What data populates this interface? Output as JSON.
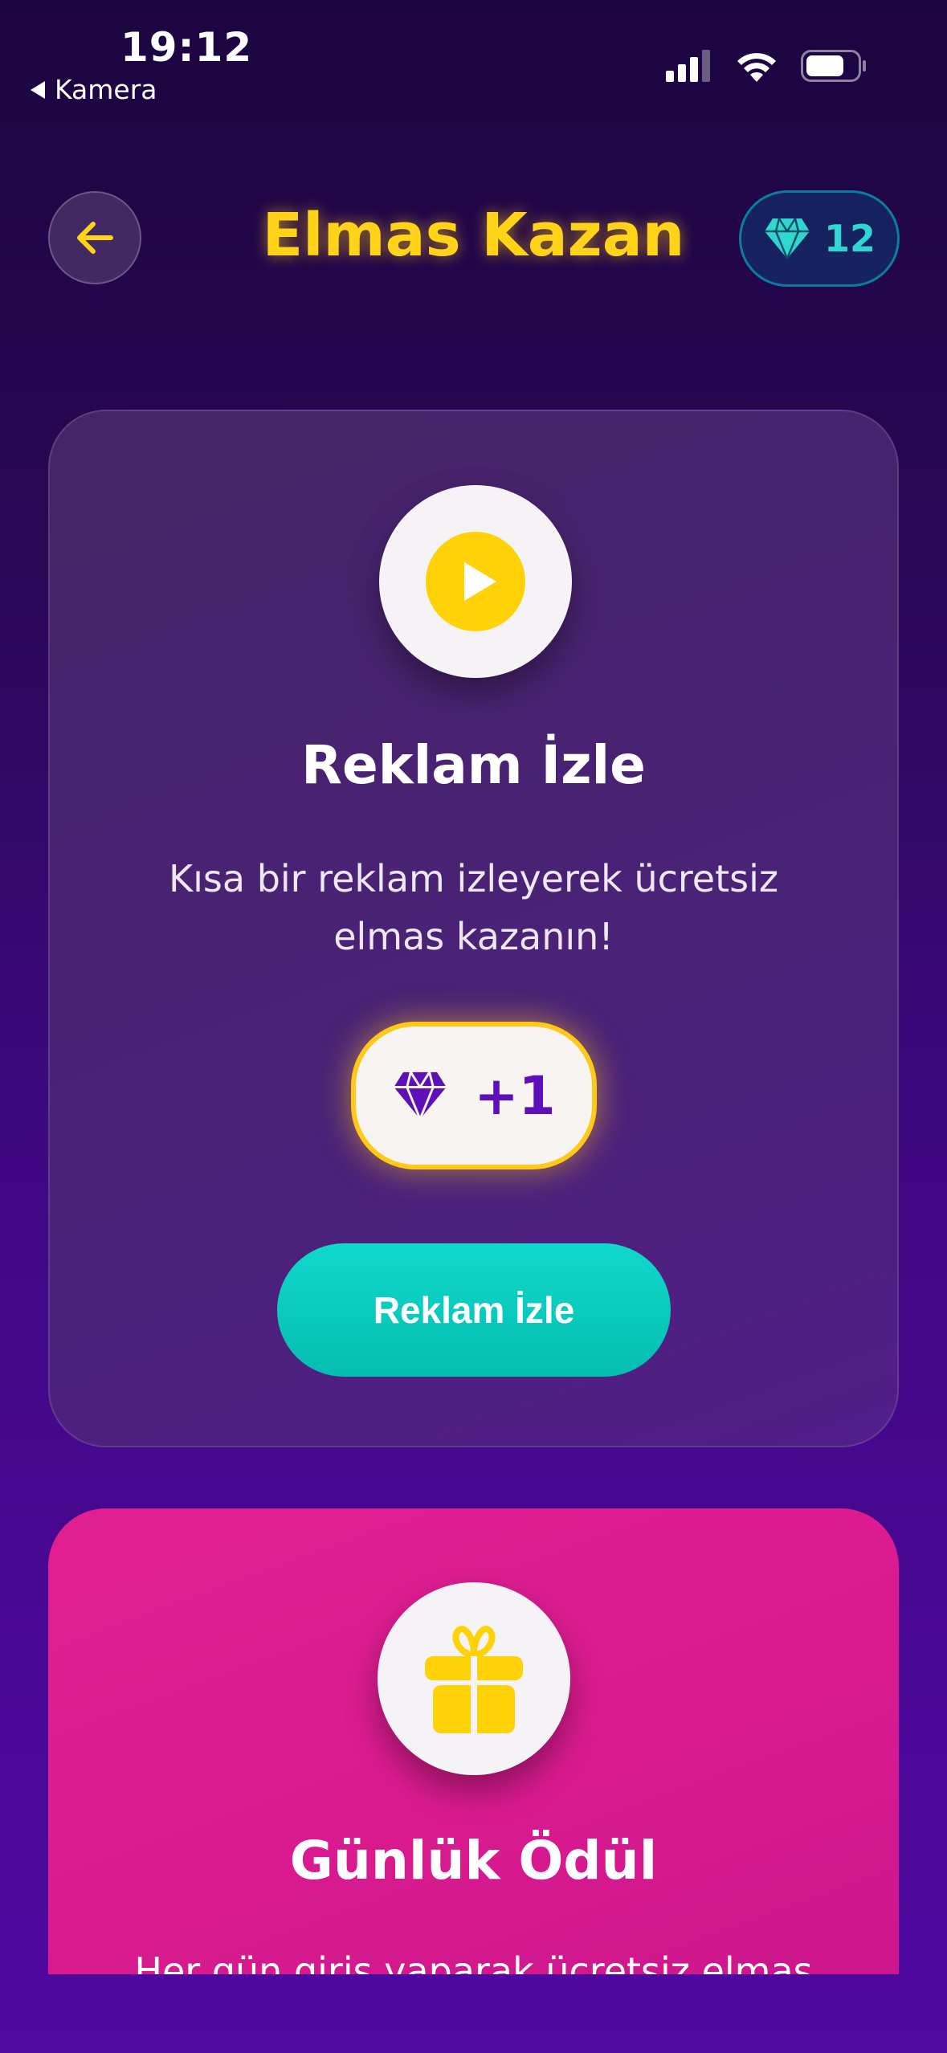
{
  "status_bar": {
    "time": "19:12",
    "back_app": "Kamera"
  },
  "header": {
    "title": "Elmas Kazan",
    "diamond_count": "12"
  },
  "ad_card": {
    "title": "Reklam İzle",
    "description": "Kısa bir reklam izleyerek ücretsiz elmas kazanın!",
    "reward": "+1",
    "button_label": "Reklam İzle"
  },
  "daily_card": {
    "title": "Günlük Ödül",
    "description": "Her gün giriş yaparak ücretsiz elmas"
  },
  "colors": {
    "accent_yellow": "#ffd31a",
    "teal": "#0fd9cc",
    "purple": "#5e10b8",
    "pink": "#e11f93"
  }
}
